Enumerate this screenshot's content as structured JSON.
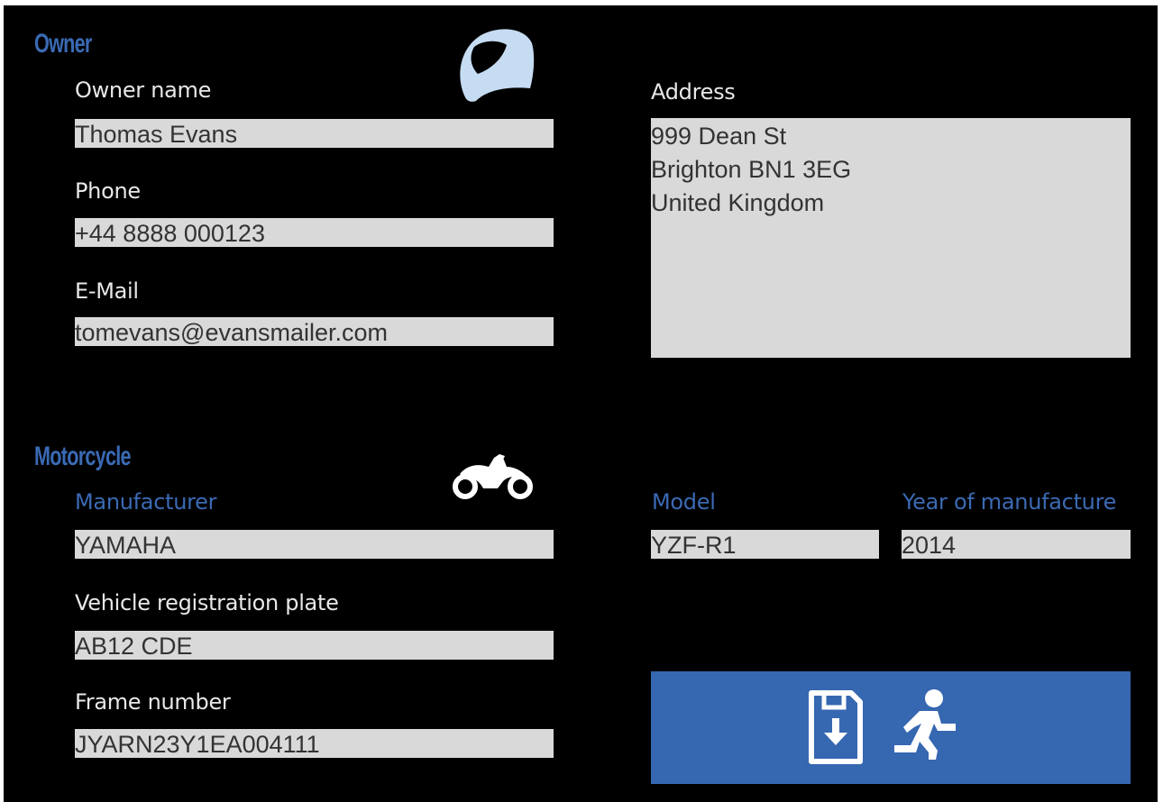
{
  "owner": {
    "section_title": "Owner",
    "icon": "helmet-icon",
    "name_label": "Owner name",
    "name_value": "Thomas Evans",
    "phone_label": "Phone",
    "phone_value": "+44 8888 000123",
    "email_label": "E-Mail",
    "email_value": "tomevans@evansmailer.com",
    "address_label": "Address",
    "address_value": "999 Dean St\nBrighton BN1 3EG\nUnited Kingdom"
  },
  "motorcycle": {
    "section_title": "Motorcycle",
    "icon": "motorcycle-icon",
    "manufacturer_label": "Manufacturer",
    "manufacturer_value": "YAMAHA",
    "model_label": "Model",
    "model_value": "YZF-R1",
    "year_label": "Year of manufacture",
    "year_value": "2014",
    "plate_label": "Vehicle registration plate",
    "plate_value": "AB12 CDE",
    "frame_label": "Frame number",
    "frame_value": "JYARN23Y1EA004111"
  },
  "actions": {
    "save_exit_icons": [
      "save-icon",
      "exit-running-man-icon"
    ]
  },
  "colors": {
    "background": "#000000",
    "accent_blue": "#3b6ab4",
    "button_blue": "#3667b1",
    "field_gray": "#d9d9d9",
    "icon_light_blue": "#c5dcf2"
  }
}
